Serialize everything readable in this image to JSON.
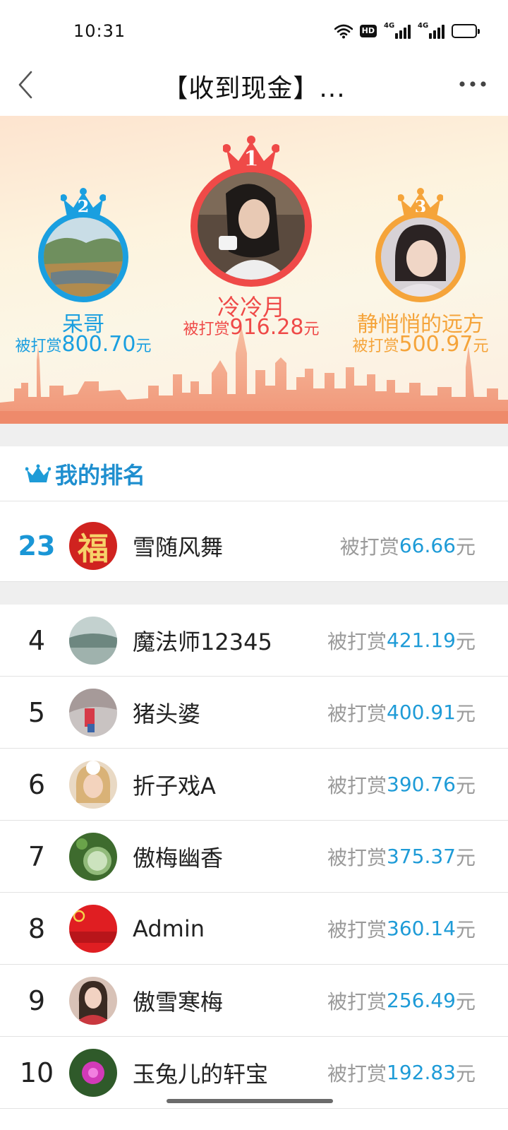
{
  "status_bar": {
    "time": "10:31",
    "icons": [
      "wifi-icon",
      "hd-icon",
      "signal-4g-icon",
      "signal-4g-icon",
      "battery-icon"
    ],
    "hd_label": "HD",
    "net_label_1": "4G",
    "net_label_2": "4G"
  },
  "header": {
    "title": "【收到现金】...",
    "back_icon": "chevron-left-icon",
    "more_icon": "more-dots-icon"
  },
  "podium": {
    "first": {
      "rank": "1",
      "name": "冷冷月",
      "reward_prefix": "被打赏",
      "amount": "916.28",
      "unit": "元",
      "color": "#ef4a48"
    },
    "second": {
      "rank": "2",
      "name": "呆哥",
      "reward_prefix": "被打赏",
      "amount": "800.70",
      "unit": "元",
      "color": "#1a9fe0"
    },
    "third": {
      "rank": "3",
      "name": "静悄悄的远方",
      "reward_prefix": "被打赏",
      "amount": "500.97",
      "unit": "元",
      "color": "#f5a43a"
    }
  },
  "my_rank": {
    "title": "我的排名",
    "rank": "23",
    "name": "雪随风舞",
    "reward_prefix": "被打赏",
    "amount": "66.66",
    "unit": "元",
    "avatar_text": "福"
  },
  "ranking": [
    {
      "rank": "4",
      "name": "魔法师12345",
      "reward_prefix": "被打赏",
      "amount": "421.19",
      "unit": "元"
    },
    {
      "rank": "5",
      "name": "猪头婆",
      "reward_prefix": "被打赏",
      "amount": "400.91",
      "unit": "元"
    },
    {
      "rank": "6",
      "name": "折子戏A",
      "reward_prefix": "被打赏",
      "amount": "390.76",
      "unit": "元"
    },
    {
      "rank": "7",
      "name": "傲梅幽香",
      "reward_prefix": "被打赏",
      "amount": "375.37",
      "unit": "元"
    },
    {
      "rank": "8",
      "name": "Admin",
      "reward_prefix": "被打赏",
      "amount": "360.14",
      "unit": "元"
    },
    {
      "rank": "9",
      "name": "傲雪寒梅",
      "reward_prefix": "被打赏",
      "amount": "256.49",
      "unit": "元"
    },
    {
      "rank": "10",
      "name": "玉兔儿的轩宝",
      "reward_prefix": "被打赏",
      "amount": "192.83",
      "unit": "元"
    }
  ],
  "colors": {
    "accent_blue": "#1e9bd7",
    "gold_crown": "#f5a43a",
    "red_crown": "#ef4a48",
    "skyline": "#f08f6f"
  }
}
